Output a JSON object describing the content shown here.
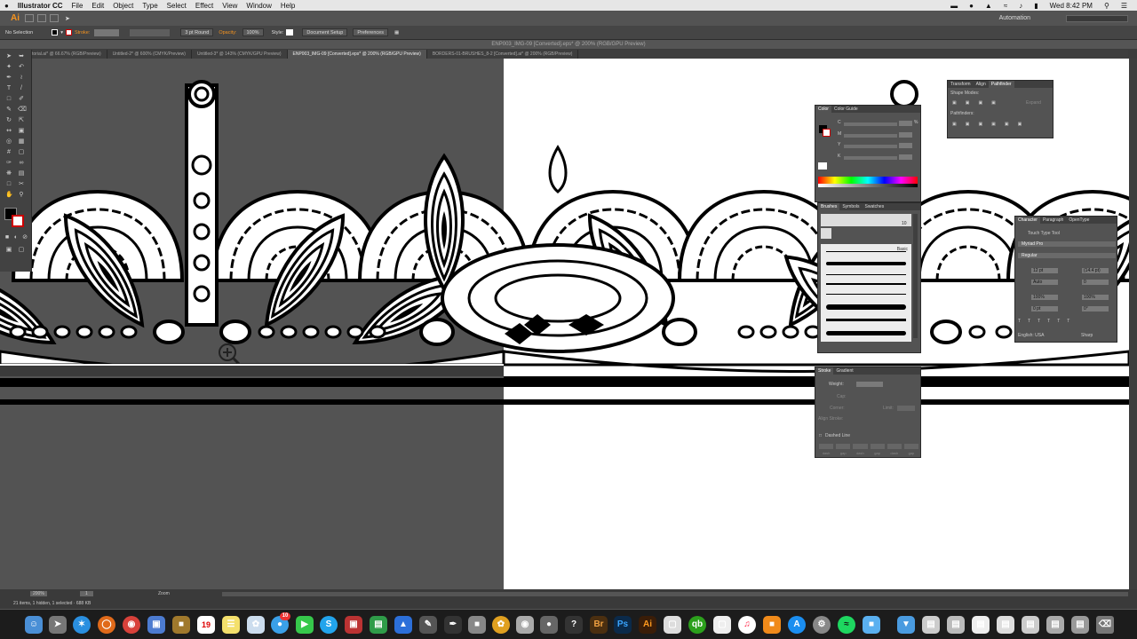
{
  "menubar": {
    "apple": "",
    "app_name": "Illustrator CC",
    "items": [
      "File",
      "Edit",
      "Object",
      "Type",
      "Select",
      "Effect",
      "View",
      "Window",
      "Help"
    ],
    "clock": "Wed 8:42 PM"
  },
  "appbar": {
    "logo": "Ai",
    "workspace": "Automation"
  },
  "control": {
    "selection": "No Selection",
    "stroke_label": "Stroke:",
    "brush": "3 pt Round",
    "opacity_label": "Opacity:",
    "opacity_value": "100%",
    "style_label": "Style:",
    "document_setup": "Document Setup",
    "preferences": "Preferences"
  },
  "document_title": "ENP003_IMG-09 [Converted].eps* @ 200% (RGB/GPU Preview)",
  "tabs": [
    "torial.ai* @ 66.67% (RGB/Preview)",
    "Untitled-2* @ 600% (CMYK/Preview)",
    "Untitled-3* @ 143% (CMYK/GPU Preview)",
    "ENP003_IMG-09 [Converted].eps* @ 200% (RGB/GPU Preview)",
    "BORDERS-01-BRUSHES_8-2 [Converted].ai* @ 200% (RGB/Preview)"
  ],
  "active_tab": 3,
  "panels": {
    "transform_group": {
      "tabs": [
        "Transform",
        "Align",
        "Pathfinder"
      ],
      "shape_modes": "Shape Modes:",
      "pathfinders": "Pathfinders:",
      "expand": "Expand"
    },
    "color": {
      "tabs": [
        "Color",
        "Color Guide"
      ],
      "channels": [
        "C",
        "M",
        "Y",
        "K"
      ],
      "unit": "%"
    },
    "brushes": {
      "tabs": [
        "Brushes",
        "Symbols",
        "Swatches"
      ],
      "label": "Basic",
      "size": "10"
    },
    "stroke": {
      "tabs": [
        "Stroke",
        "Gradient"
      ],
      "weight": "Weight:",
      "cap": "Cap:",
      "corner": "Corner:",
      "limit": "Limit:",
      "align": "Align Stroke:",
      "dashed": "Dashed Line",
      "dash_labels": [
        "dash",
        "gap",
        "dash",
        "gap",
        "dash",
        "gap"
      ]
    },
    "character": {
      "tabs": [
        "Character",
        "Paragraph",
        "OpenType"
      ],
      "touch_type": "Touch Type Tool",
      "font": "Myriad Pro",
      "style": "Regular",
      "size": "12 pt",
      "leading": "(14.4 pt)",
      "kerning": "Auto",
      "tracking": "0",
      "hscale": "100%",
      "vscale": "100%",
      "baseline": "0 pt",
      "rotation": "0°",
      "language": "English: USA",
      "aa": "Sharp"
    }
  },
  "status": {
    "zoom": "200%",
    "page": "1",
    "tool": "Zoom",
    "info": "21 items, 1 hidden, 1 selected · 688 KB"
  },
  "dock_icons": [
    "finder-icon",
    "launchpad-icon",
    "safari-icon",
    "firefox-icon",
    "chrome-icon",
    "preview-icon",
    "folder-icon",
    "calendar-icon",
    "notes-icon",
    "photos-icon",
    "messages-icon",
    "facetime-icon",
    "skype-icon",
    "app-icon",
    "numbers-icon",
    "keynote-icon",
    "text-icon",
    "script-icon",
    "color-icon",
    "disk-icon",
    "mic-icon",
    "help-icon",
    "bridge-icon",
    "photoshop-icon",
    "illustrator-icon",
    "doc-icon",
    "quickbooks-icon",
    "doc-icon-2",
    "itunes-icon",
    "books-icon",
    "appstore-icon",
    "preferences-icon",
    "spotify-icon",
    "folder-icon-2",
    "downloads-icon",
    "stack-icon",
    "stack-icon-2",
    "stack-icon-3",
    "trash-icon"
  ],
  "dock_labels": {
    "calendar": "19",
    "bridge": "Br",
    "photoshop": "Ps",
    "illustrator": "Ai",
    "badge": "10"
  }
}
